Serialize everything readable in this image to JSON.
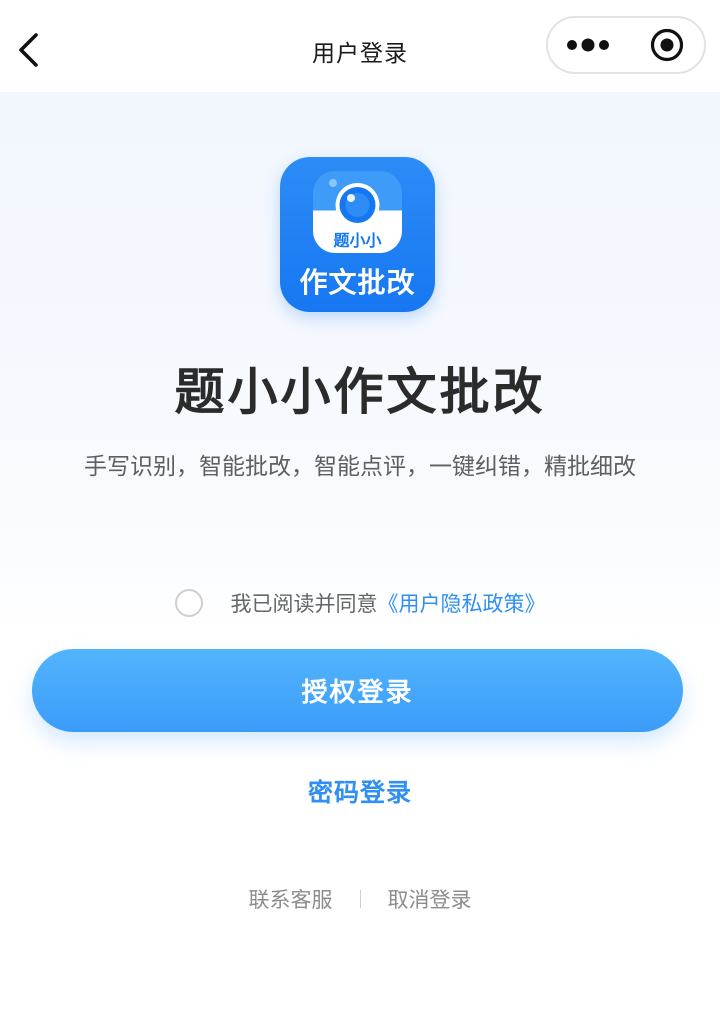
{
  "navbar": {
    "title": "用户登录",
    "back_icon": "chevron-left-icon",
    "more_icon": "more-dots-icon",
    "close_icon": "target-close-icon"
  },
  "logo": {
    "card_label": "题小小",
    "text": "作文批改",
    "brand_color": "#1677f2"
  },
  "app": {
    "name": "题小小作文批改",
    "description": "手写识别，智能批改，智能点评，一键纠错，精批细改"
  },
  "agreement": {
    "checked": false,
    "text": "我已阅读并同意",
    "link_text": "《用户隐私政策》",
    "link_color": "#2f8ff5"
  },
  "buttons": {
    "authorize_login": "授权登录",
    "password_login": "密码登录"
  },
  "footer": {
    "contact_service": "联系客服",
    "cancel_login": "取消登录"
  },
  "colors": {
    "primary_button": "#3a9cf9",
    "accent": "#2f8ff5",
    "title_text": "#2b2b2b"
  }
}
